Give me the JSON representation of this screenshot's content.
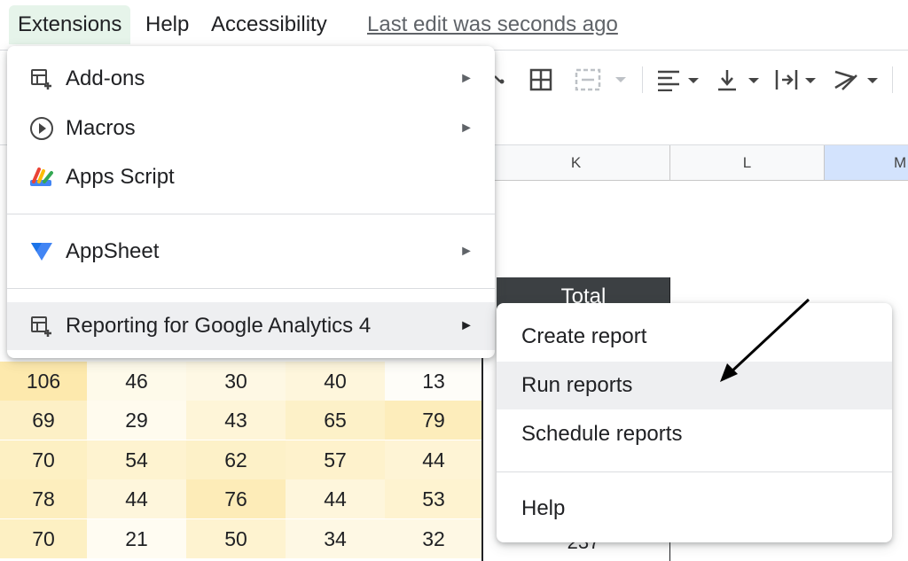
{
  "menubar": {
    "items": [
      "Extensions",
      "Help",
      "Accessibility"
    ],
    "last_edit": "Last edit was seconds ago"
  },
  "columns": [
    "K",
    "L",
    "M"
  ],
  "grid": {
    "total_header": "Total",
    "rows": [
      [
        "106",
        "46",
        "30",
        "40",
        "13"
      ],
      [
        "69",
        "29",
        "43",
        "65",
        "79"
      ],
      [
        "70",
        "54",
        "62",
        "57",
        "44"
      ],
      [
        "78",
        "44",
        "76",
        "44",
        "53"
      ],
      [
        "70",
        "21",
        "50",
        "34",
        "32"
      ]
    ],
    "heat": [
      [
        "#fde9ad",
        "#fefaea",
        "#fef8e4",
        "#fef6dc",
        "#fefdf8"
      ],
      [
        "#fdf0c6",
        "#fffbee",
        "#fef5d8",
        "#fdf1c8",
        "#fdedbb"
      ],
      [
        "#fdf0c3",
        "#fef3d0",
        "#fdf1c8",
        "#fef2cc",
        "#fef4d5"
      ],
      [
        "#fdeebe",
        "#fef6dc",
        "#fdecb8",
        "#fef6dc",
        "#fef3d0"
      ],
      [
        "#fdf0c3",
        "#fffcf2",
        "#fef3d0",
        "#fef8e4",
        "#fef8e4"
      ]
    ]
  },
  "extensions_menu": {
    "items": [
      {
        "label": "Add-ons",
        "icon": "addons-icon",
        "submenu": true
      },
      {
        "label": "Macros",
        "icon": "play-circle-icon",
        "submenu": true
      },
      {
        "label": "Apps Script",
        "icon": "apps-script-icon",
        "submenu": false
      },
      {
        "label": "AppSheet",
        "icon": "appsheet-icon",
        "submenu": true
      },
      {
        "label": "Reporting for Google Analytics 4",
        "icon": "addons-icon",
        "submenu": true
      }
    ],
    "arrow": "►"
  },
  "submenu": {
    "items": [
      "Create report",
      "Run reports",
      "Schedule reports",
      "Help"
    ],
    "highlighted": "Run reports"
  },
  "colors": {
    "active_menu": "#e6f4ea",
    "menu_highlight": "#eeeff1",
    "total_header_bg": "#3c4043",
    "appsheet_blue": "#4285f4"
  }
}
